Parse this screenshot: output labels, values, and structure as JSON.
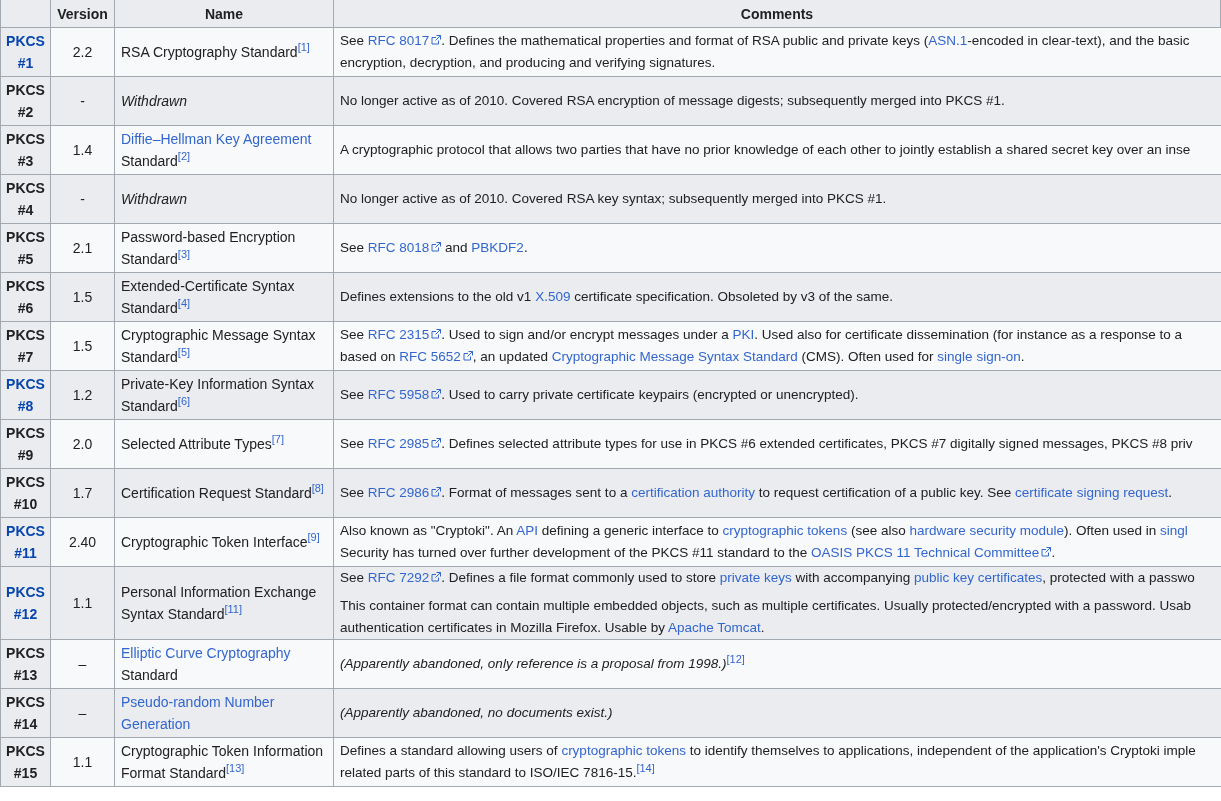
{
  "table": {
    "columns": [
      "Version",
      "Name",
      "Comments"
    ],
    "rows": [
      {
        "id": {
          "text": "PKCS #1",
          "link": true
        },
        "version": "2.2",
        "name": [
          [
            {
              "t": "RSA Cryptography Standard",
              "kind": "plain"
            },
            {
              "t": "[1]",
              "kind": "ref"
            }
          ]
        ],
        "comments": [
          [
            [
              {
                "t": "See ",
                "kind": "plain"
              },
              {
                "t": "RFC 8017",
                "kind": "ext_link"
              },
              {
                "t": ". Defines the mathematical properties and format of RSA public and private keys (",
                "kind": "plain"
              },
              {
                "t": "ASN.1",
                "kind": "link"
              },
              {
                "t": "-encoded in clear-text), and the basic",
                "kind": "plain"
              }
            ],
            [
              {
                "t": "encryption, decryption, and producing and verifying signatures.",
                "kind": "plain"
              }
            ]
          ]
        ]
      },
      {
        "id": {
          "text": "PKCS #2",
          "link": false
        },
        "version": "-",
        "name": [
          [
            {
              "t": "Withdrawn",
              "kind": "italic"
            }
          ]
        ],
        "comments": [
          [
            [
              {
                "t": "No longer active as of 2010. Covered RSA encryption of message digests; subsequently merged into PKCS #1.",
                "kind": "plain"
              }
            ]
          ]
        ]
      },
      {
        "id": {
          "text": "PKCS #3",
          "link": false
        },
        "version": "1.4",
        "name": [
          [
            {
              "t": "Diffie–Hellman Key Agreement",
              "kind": "link"
            }
          ],
          [
            {
              "t": "Standard",
              "kind": "plain"
            },
            {
              "t": "[2]",
              "kind": "ref"
            }
          ]
        ],
        "comments": [
          [
            [
              {
                "t": "A cryptographic protocol that allows two parties that have no prior knowledge of each other to jointly establish a shared secret key over an inse",
                "kind": "plain"
              }
            ]
          ]
        ]
      },
      {
        "id": {
          "text": "PKCS #4",
          "link": false
        },
        "version": "-",
        "name": [
          [
            {
              "t": "Withdrawn",
              "kind": "italic"
            }
          ]
        ],
        "comments": [
          [
            [
              {
                "t": "No longer active as of 2010. Covered RSA key syntax; subsequently merged into PKCS #1.",
                "kind": "plain"
              }
            ]
          ]
        ]
      },
      {
        "id": {
          "text": "PKCS #5",
          "link": false
        },
        "version": "2.1",
        "name": [
          [
            {
              "t": "Password-based Encryption",
              "kind": "plain"
            }
          ],
          [
            {
              "t": "Standard",
              "kind": "plain"
            },
            {
              "t": "[3]",
              "kind": "ref"
            }
          ]
        ],
        "comments": [
          [
            [
              {
                "t": "See ",
                "kind": "plain"
              },
              {
                "t": "RFC 8018",
                "kind": "ext_link"
              },
              {
                "t": " and ",
                "kind": "plain"
              },
              {
                "t": "PBKDF2",
                "kind": "link"
              },
              {
                "t": ".",
                "kind": "plain"
              }
            ]
          ]
        ]
      },
      {
        "id": {
          "text": "PKCS #6",
          "link": false
        },
        "version": "1.5",
        "name": [
          [
            {
              "t": "Extended-Certificate Syntax",
              "kind": "plain"
            }
          ],
          [
            {
              "t": "Standard",
              "kind": "plain"
            },
            {
              "t": "[4]",
              "kind": "ref"
            }
          ]
        ],
        "comments": [
          [
            [
              {
                "t": "Defines extensions to the old v1 ",
                "kind": "plain"
              },
              {
                "t": "X.509",
                "kind": "link"
              },
              {
                "t": " certificate specification. Obsoleted by v3 of the same.",
                "kind": "plain"
              }
            ]
          ]
        ]
      },
      {
        "id": {
          "text": "PKCS #7",
          "link": false
        },
        "version": "1.5",
        "name": [
          [
            {
              "t": "Cryptographic Message Syntax",
              "kind": "plain"
            }
          ],
          [
            {
              "t": "Standard",
              "kind": "plain"
            },
            {
              "t": "[5]",
              "kind": "ref"
            }
          ]
        ],
        "comments": [
          [
            [
              {
                "t": "See ",
                "kind": "plain"
              },
              {
                "t": "RFC 2315",
                "kind": "ext_link"
              },
              {
                "t": ". Used to sign and/or encrypt messages under a ",
                "kind": "plain"
              },
              {
                "t": "PKI",
                "kind": "link"
              },
              {
                "t": ". Used also for certificate dissemination (for instance as a response to a",
                "kind": "plain"
              }
            ],
            [
              {
                "t": "based on ",
                "kind": "plain"
              },
              {
                "t": "RFC 5652",
                "kind": "ext_link"
              },
              {
                "t": ", an updated ",
                "kind": "plain"
              },
              {
                "t": "Cryptographic Message Syntax Standard",
                "kind": "link"
              },
              {
                "t": " (CMS). Often used for ",
                "kind": "plain"
              },
              {
                "t": "single sign-on",
                "kind": "link"
              },
              {
                "t": ".",
                "kind": "plain"
              }
            ]
          ]
        ]
      },
      {
        "id": {
          "text": "PKCS #8",
          "link": true
        },
        "version": "1.2",
        "name": [
          [
            {
              "t": "Private-Key Information Syntax",
              "kind": "plain"
            }
          ],
          [
            {
              "t": "Standard",
              "kind": "plain"
            },
            {
              "t": "[6]",
              "kind": "ref"
            }
          ]
        ],
        "comments": [
          [
            [
              {
                "t": "See ",
                "kind": "plain"
              },
              {
                "t": "RFC 5958",
                "kind": "ext_link"
              },
              {
                "t": ". Used to carry private certificate keypairs (encrypted or unencrypted).",
                "kind": "plain"
              }
            ]
          ]
        ]
      },
      {
        "id": {
          "text": "PKCS #9",
          "link": false
        },
        "version": "2.0",
        "name": [
          [
            {
              "t": "Selected Attribute Types",
              "kind": "plain"
            },
            {
              "t": "[7]",
              "kind": "ref"
            }
          ]
        ],
        "comments": [
          [
            [
              {
                "t": "See ",
                "kind": "plain"
              },
              {
                "t": "RFC 2985",
                "kind": "ext_link"
              },
              {
                "t": ". Defines selected attribute types for use in PKCS #6 extended certificates, PKCS #7 digitally signed messages, PKCS #8 priv",
                "kind": "plain"
              }
            ]
          ]
        ]
      },
      {
        "id": {
          "text": "PKCS #10",
          "link": false
        },
        "version": "1.7",
        "name": [
          [
            {
              "t": "Certification Request Standard",
              "kind": "plain"
            },
            {
              "t": "[8]",
              "kind": "ref"
            }
          ]
        ],
        "comments": [
          [
            [
              {
                "t": "See ",
                "kind": "plain"
              },
              {
                "t": "RFC 2986",
                "kind": "ext_link"
              },
              {
                "t": ". Format of messages sent to a ",
                "kind": "plain"
              },
              {
                "t": "certification authority",
                "kind": "link"
              },
              {
                "t": " to request certification of a public key. See ",
                "kind": "plain"
              },
              {
                "t": "certificate signing request",
                "kind": "link"
              },
              {
                "t": ".",
                "kind": "plain"
              }
            ]
          ]
        ]
      },
      {
        "id": {
          "text": "PKCS #11",
          "link": true
        },
        "version": "2.40",
        "name": [
          [
            {
              "t": "Cryptographic Token Interface",
              "kind": "plain"
            },
            {
              "t": "[9]",
              "kind": "ref"
            }
          ]
        ],
        "comments": [
          [
            [
              {
                "t": "Also known as \"Cryptoki\". An ",
                "kind": "plain"
              },
              {
                "t": "API",
                "kind": "link"
              },
              {
                "t": " defining a generic interface to ",
                "kind": "plain"
              },
              {
                "t": "cryptographic tokens",
                "kind": "link"
              },
              {
                "t": " (see also ",
                "kind": "plain"
              },
              {
                "t": "hardware security module",
                "kind": "link"
              },
              {
                "t": "). Often used in ",
                "kind": "plain"
              },
              {
                "t": "singl",
                "kind": "link"
              }
            ],
            [
              {
                "t": "Security has turned over further development of the PKCS #11 standard to the ",
                "kind": "plain"
              },
              {
                "t": "OASIS PKCS 11 Technical Committee",
                "kind": "ext_link"
              },
              {
                "t": ".",
                "kind": "plain"
              }
            ]
          ]
        ]
      },
      {
        "id": {
          "text": "PKCS #12",
          "link": true
        },
        "version": "1.1",
        "name": [
          [
            {
              "t": "Personal Information Exchange",
              "kind": "plain"
            }
          ],
          [
            {
              "t": "Syntax Standard",
              "kind": "plain"
            },
            {
              "t": "[11]",
              "kind": "ref"
            }
          ]
        ],
        "comments": [
          [
            [
              {
                "t": "See ",
                "kind": "plain"
              },
              {
                "t": "RFC 7292",
                "kind": "ext_link"
              },
              {
                "t": ". Defines a file format commonly used to store ",
                "kind": "plain"
              },
              {
                "t": "private keys",
                "kind": "link"
              },
              {
                "t": " with accompanying ",
                "kind": "plain"
              },
              {
                "t": "public key certificates",
                "kind": "link"
              },
              {
                "t": ", protected with a passwo",
                "kind": "plain"
              }
            ]
          ],
          [
            [
              {
                "t": "This container format can contain multiple embedded objects, such as multiple certificates. Usually protected/encrypted with a password. Usab",
                "kind": "plain"
              }
            ],
            [
              {
                "t": "authentication certificates in Mozilla Firefox. Usable by ",
                "kind": "plain"
              },
              {
                "t": "Apache Tomcat",
                "kind": "link"
              },
              {
                "t": ".",
                "kind": "plain"
              }
            ]
          ]
        ]
      },
      {
        "id": {
          "text": "PKCS #13",
          "link": false
        },
        "version": "–",
        "name": [
          [
            {
              "t": "Elliptic Curve Cryptography",
              "kind": "link"
            }
          ],
          [
            {
              "t": "Standard",
              "kind": "plain"
            }
          ]
        ],
        "comments": [
          [
            [
              {
                "t": "(Apparently abandoned, only reference is a proposal from 1998.)",
                "kind": "italic"
              },
              {
                "t": "[12]",
                "kind": "ref"
              }
            ]
          ]
        ]
      },
      {
        "id": {
          "text": "PKCS #14",
          "link": false
        },
        "version": "–",
        "name": [
          [
            {
              "t": "Pseudo-random Number",
              "kind": "link"
            }
          ],
          [
            {
              "t": "Generation",
              "kind": "link"
            }
          ]
        ],
        "comments": [
          [
            [
              {
                "t": "(Apparently abandoned, no documents exist.)",
                "kind": "italic"
              }
            ]
          ]
        ]
      },
      {
        "id": {
          "text": "PKCS #15",
          "link": false
        },
        "version": "1.1",
        "name": [
          [
            {
              "t": "Cryptographic Token Information",
              "kind": "plain"
            }
          ],
          [
            {
              "t": "Format Standard",
              "kind": "plain"
            },
            {
              "t": "[13]",
              "kind": "ref"
            }
          ]
        ],
        "comments": [
          [
            [
              {
                "t": "Defines a standard allowing users of ",
                "kind": "plain"
              },
              {
                "t": "cryptographic tokens",
                "kind": "link"
              },
              {
                "t": " to identify themselves to applications, independent of the application's Cryptoki imple",
                "kind": "plain"
              }
            ],
            [
              {
                "t": "related parts of this standard to ISO/IEC 7816-15.",
                "kind": "plain"
              },
              {
                "t": "[14]",
                "kind": "ref"
              }
            ]
          ]
        ]
      }
    ]
  }
}
